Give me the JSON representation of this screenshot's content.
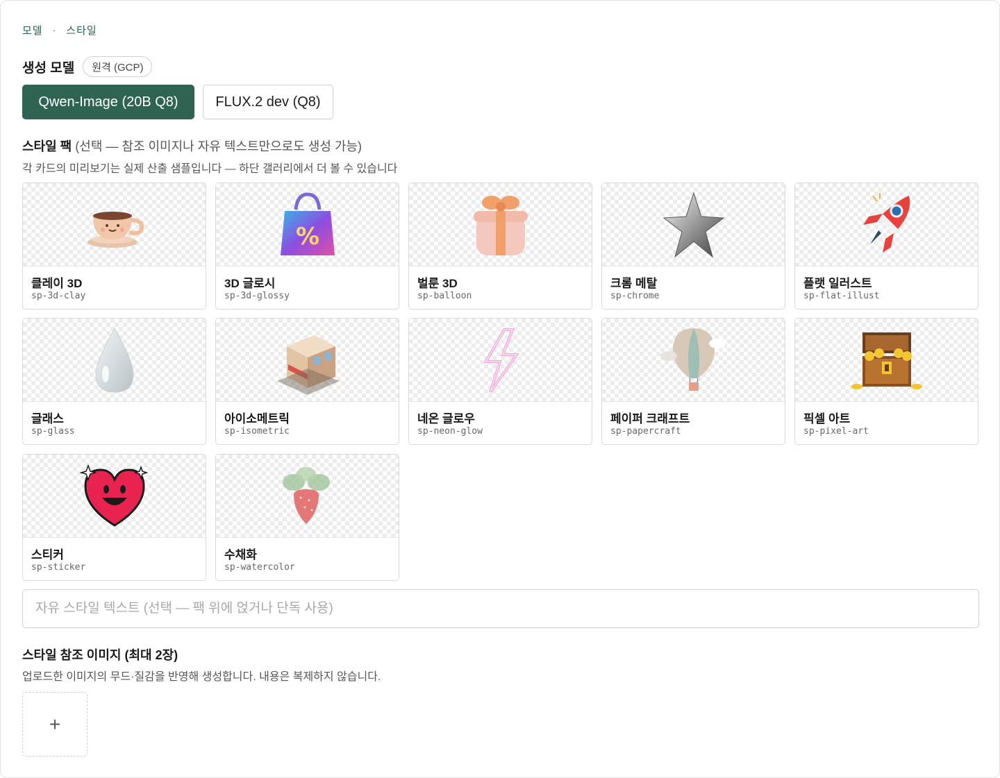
{
  "breadcrumb": {
    "step1": "모델",
    "sep": "·",
    "step2": "스타일"
  },
  "model": {
    "label": "생성 모델",
    "badge": "원격 (GCP)",
    "options": [
      {
        "label": "Qwen-Image (20B Q8)",
        "selected": true
      },
      {
        "label": "FLUX.2 dev (Q8)",
        "selected": false
      }
    ]
  },
  "style_pack": {
    "title": "스타일 팩",
    "note": "(선택 — 참조 이미지나 자유 텍스트만으로도 생성 가능)",
    "subtitle": "각 카드의 미리보기는 실제 산출 샘플입니다 — 하단 갤러리에서 더 볼 수 있습니다",
    "cards": [
      {
        "title": "클레이 3D",
        "code": "sp-3d-clay",
        "icon": "clay-coffee-cup-icon"
      },
      {
        "title": "3D 글로시",
        "code": "sp-3d-glossy",
        "icon": "glossy-shopping-bag-icon"
      },
      {
        "title": "벌룬 3D",
        "code": "sp-balloon",
        "icon": "balloon-gift-box-icon"
      },
      {
        "title": "크롬 메탈",
        "code": "sp-chrome",
        "icon": "chrome-star-icon"
      },
      {
        "title": "플랫 일러스트",
        "code": "sp-flat-illust",
        "icon": "flat-rocket-icon"
      },
      {
        "title": "글래스",
        "code": "sp-glass",
        "icon": "glass-water-drop-icon"
      },
      {
        "title": "아이소메트릭",
        "code": "sp-isometric",
        "icon": "isometric-shop-icon"
      },
      {
        "title": "네온 글로우",
        "code": "sp-neon-glow",
        "icon": "neon-lightning-icon"
      },
      {
        "title": "페이퍼 크래프트",
        "code": "sp-papercraft",
        "icon": "paper-hot-air-balloon-icon"
      },
      {
        "title": "픽셀 아트",
        "code": "sp-pixel-art",
        "icon": "pixel-treasure-chest-icon"
      },
      {
        "title": "스티커",
        "code": "sp-sticker",
        "icon": "sticker-heart-icon"
      },
      {
        "title": "수채화",
        "code": "sp-watercolor",
        "icon": "watercolor-strawberry-icon"
      }
    ]
  },
  "free_text": {
    "placeholder": "자유 스타일 텍스트 (선택 — 팩 위에 얹거나 단독 사용)",
    "value": ""
  },
  "reference": {
    "title": "스타일 참조 이미지 (최대 2장)",
    "subtitle": "업로드한 이미지의 무드·질감을 반영해 생성합니다. 내용은 복제하지 않습니다.",
    "upload_label": "+"
  },
  "colors": {
    "accent": "#2f6452",
    "breadcrumb": "#2b5f4d"
  }
}
